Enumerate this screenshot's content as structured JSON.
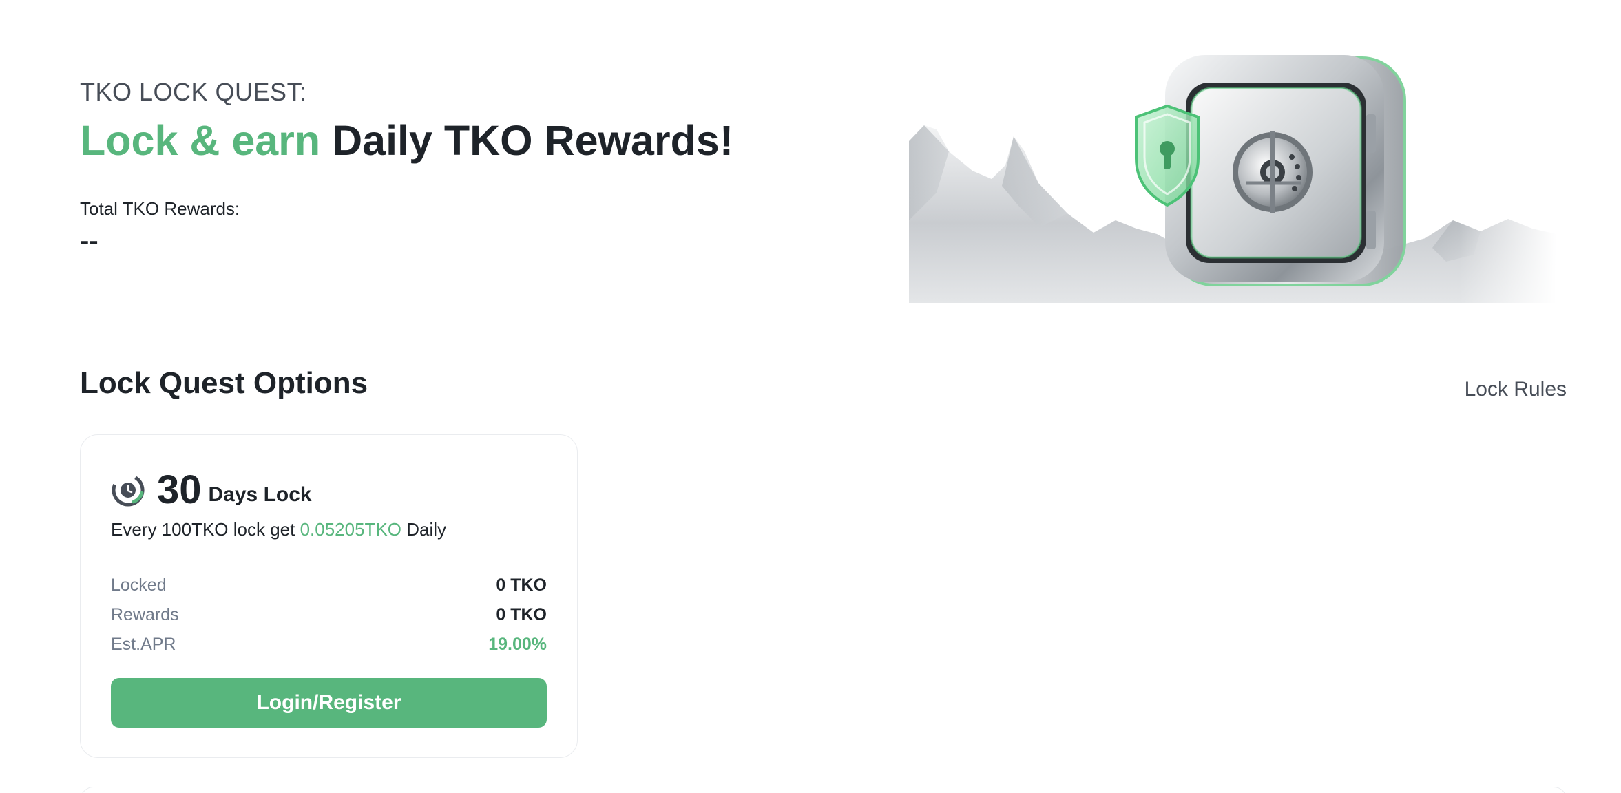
{
  "hero": {
    "eyebrow": "TKO LOCK QUEST:",
    "title_accent": "Lock & earn",
    "title_rest": "Daily TKO Rewards!",
    "total_label": "Total TKO Rewards:",
    "total_value": "--"
  },
  "section": {
    "title": "Lock Quest Options",
    "rules_link": "Lock Rules"
  },
  "card": {
    "icon": "lock-timer-icon",
    "days": "30",
    "days_label": "Days Lock",
    "desc_prefix": "Every 100TKO lock get",
    "desc_amount": "0.05205TKO",
    "desc_suffix": "Daily",
    "stats": [
      {
        "label": "Locked",
        "value": "0 TKO"
      },
      {
        "label": "Rewards",
        "value": "0 TKO"
      },
      {
        "label": "Est.APR",
        "value": "19.00%"
      }
    ],
    "button_label": "Login/Register"
  },
  "colors": {
    "accent": "#58b67d",
    "text": "#1e2329",
    "muted": "#707a8a",
    "border": "#eaecef"
  }
}
